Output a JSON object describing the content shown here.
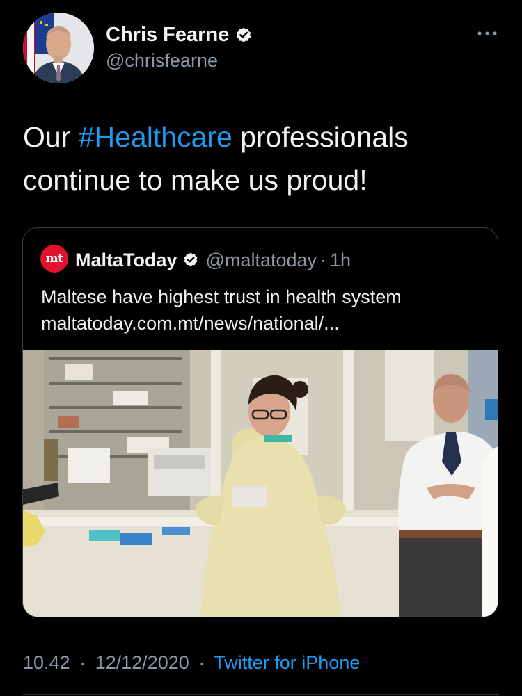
{
  "author": {
    "name": "Chris Fearne",
    "handle": "@chrisfearne",
    "verified": true,
    "verified_icon": "verified-badge-icon"
  },
  "more_icon": "more-horizontal-icon",
  "tweet": {
    "text_before": "Our ",
    "hashtag": "#Healthcare",
    "text_after": " professionals continue to make us proud!"
  },
  "quote": {
    "logo_text": "mt",
    "name": "MaltaToday",
    "handle": "@maltatoday",
    "separator": "·",
    "time": "1h",
    "headline": "Maltese have highest trust in health system",
    "link": "maltatoday.com.mt/news/national/..."
  },
  "meta": {
    "time": "10.42",
    "separator": "·",
    "date": "12/12/2020",
    "source": "Twitter for iPhone"
  },
  "colors": {
    "background": "#000000",
    "link": "#1d9bf0",
    "secondary": "#8b98a5",
    "brand_red": "#e2142d"
  }
}
